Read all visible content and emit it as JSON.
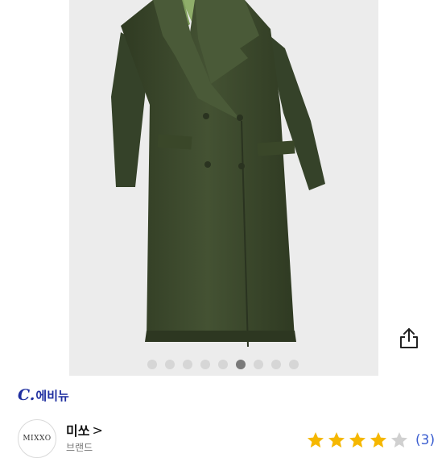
{
  "product": {
    "image_count": 9,
    "active_image_index": 5,
    "coat_color": "#3e4a2e",
    "lining_color": "#8fae6a"
  },
  "brand": {
    "logo_letter": "C.",
    "logo_text": "에비뉴",
    "color": "#1f2fa0"
  },
  "seller": {
    "avatar_text": "MIXXO",
    "name": "미쏘",
    "chevron": ">",
    "subtitle": "브랜드"
  },
  "rating": {
    "stars": 4,
    "max_stars": 5,
    "review_count": "(3)",
    "star_color": "#f5b700",
    "empty_star_color": "#d0d0d0"
  },
  "icons": {
    "share": "share-icon"
  }
}
